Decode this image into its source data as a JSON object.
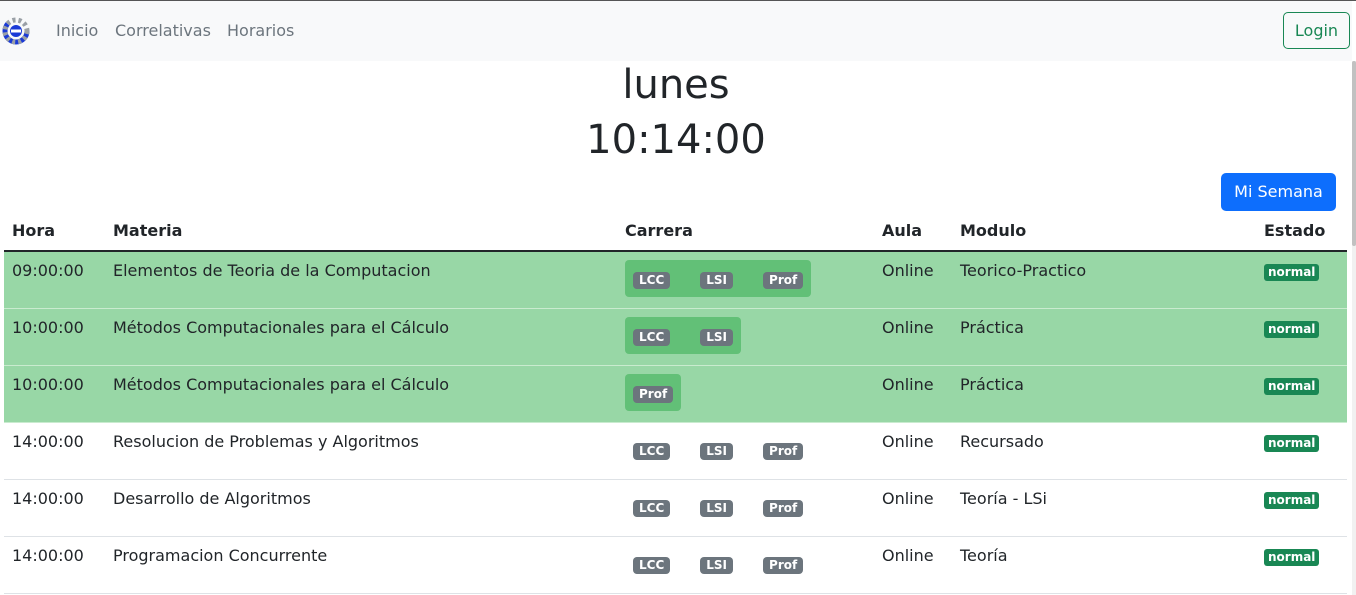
{
  "nav": {
    "links": [
      "Inicio",
      "Correlativas",
      "Horarios"
    ],
    "login_label": "Login"
  },
  "header": {
    "day": "lunes",
    "time": "10:14:00",
    "week_button": "Mi Semana"
  },
  "table": {
    "columns": [
      "Hora",
      "Materia",
      "Carrera",
      "Aula",
      "Modulo",
      "Estado"
    ],
    "rows": [
      {
        "hora": "09:00:00",
        "materia": "Elementos de Teoria de la Computacion",
        "carreras": [
          "LCC",
          "LSI",
          "Prof"
        ],
        "aula": "Online",
        "modulo": "Teorico-Practico",
        "estado": "normal",
        "highlighted": true
      },
      {
        "hora": "10:00:00",
        "materia": "Métodos Computacionales para el Cálculo",
        "carreras": [
          "LCC",
          "LSI"
        ],
        "aula": "Online",
        "modulo": "Práctica",
        "estado": "normal",
        "highlighted": true
      },
      {
        "hora": "10:00:00",
        "materia": "Métodos Computacionales para el Cálculo",
        "carreras": [
          "Prof"
        ],
        "aula": "Online",
        "modulo": "Práctica",
        "estado": "normal",
        "highlighted": true
      },
      {
        "hora": "14:00:00",
        "materia": "Resolucion de Problemas y Algoritmos",
        "carreras": [
          "LCC",
          "LSI",
          "Prof"
        ],
        "aula": "Online",
        "modulo": "Recursado",
        "estado": "normal",
        "highlighted": false
      },
      {
        "hora": "14:00:00",
        "materia": "Desarrollo de Algoritmos",
        "carreras": [
          "LCC",
          "LSI",
          "Prof"
        ],
        "aula": "Online",
        "modulo": "Teoría - LSi",
        "estado": "normal",
        "highlighted": false
      },
      {
        "hora": "14:00:00",
        "materia": "Programacion Concurrente",
        "carreras": [
          "LCC",
          "LSI",
          "Prof"
        ],
        "aula": "Online",
        "modulo": "Teoría",
        "estado": "normal",
        "highlighted": false
      }
    ]
  },
  "colors": {
    "highlight_row": "#98d7a6",
    "highlight_box": "#62c077",
    "badge_gray": "#6c757d",
    "badge_green": "#198754",
    "primary": "#0d6efd"
  }
}
